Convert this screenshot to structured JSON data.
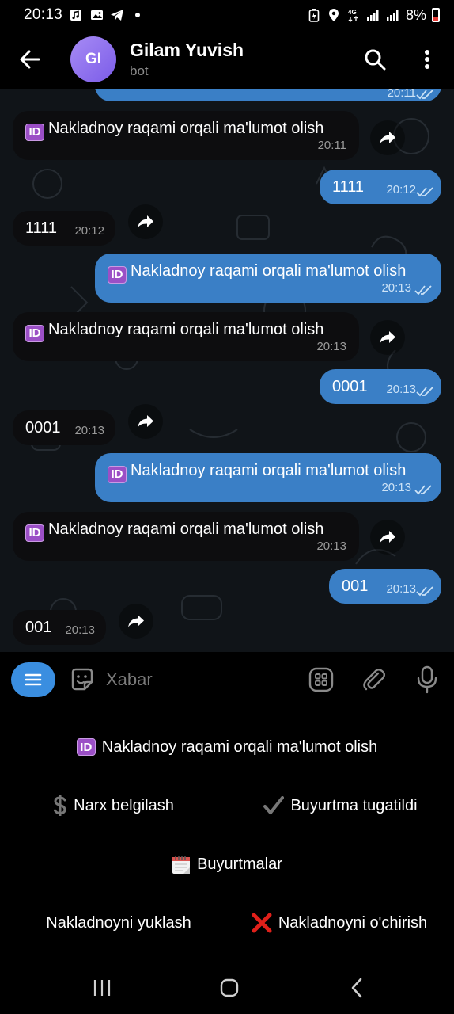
{
  "status_bar": {
    "time": "20:13",
    "battery": "8%"
  },
  "header": {
    "avatar_initials": "GI",
    "title": "Gilam Yuvish",
    "subtitle": "bot"
  },
  "messages": [
    {
      "dir": "out",
      "text": "",
      "time": "20:11"
    },
    {
      "dir": "in",
      "text": "Nakladnoy raqami orqali ma'lumot olish",
      "id_badge": "ID",
      "time": "20:11"
    },
    {
      "dir": "out",
      "text": "1111",
      "time": "20:12"
    },
    {
      "dir": "in",
      "text": "1111",
      "time": "20:12"
    },
    {
      "dir": "out",
      "text": "Nakladnoy raqami orqali ma'lumot olish",
      "id_badge": "ID",
      "time": "20:13"
    },
    {
      "dir": "in",
      "text": "Nakladnoy raqami orqali ma'lumot olish",
      "id_badge": "ID",
      "time": "20:13"
    },
    {
      "dir": "out",
      "text": "0001",
      "time": "20:13"
    },
    {
      "dir": "in",
      "text": "0001",
      "time": "20:13"
    },
    {
      "dir": "out",
      "text": "Nakladnoy raqami orqali ma'lumot olish",
      "id_badge": "ID",
      "time": "20:13"
    },
    {
      "dir": "in",
      "text": "Nakladnoy raqami orqali ma'lumot olish",
      "id_badge": "ID",
      "time": "20:13"
    },
    {
      "dir": "out",
      "text": "001",
      "time": "20:13"
    },
    {
      "dir": "in",
      "text": "001",
      "time": "20:13"
    }
  ],
  "input": {
    "placeholder": "Xabar"
  },
  "keyboard": {
    "buttons": [
      {
        "label": "Nakladnoy raqami orqali ma'lumot olish",
        "emoji": "id-badge"
      },
      {
        "label": "Narx belgilash",
        "emoji": "dollar-sign"
      },
      {
        "label": "Buyurtma tugatildi",
        "emoji": "check-mark"
      },
      {
        "label": "Buyurtmalar",
        "emoji": "calendar"
      },
      {
        "label": "Nakladnoyni yuklash",
        "emoji": ""
      },
      {
        "label": "Nakladnoyni o'chirish",
        "emoji": "cross-mark"
      }
    ],
    "id_badge_text": "ID"
  },
  "colors": {
    "accent": "#3a8ee0",
    "outgoing_bubble": "#3a7fc6",
    "incoming_bubble": "#0d0d0f",
    "chat_bg": "#101418",
    "id_badge": "#9b4fc6"
  }
}
